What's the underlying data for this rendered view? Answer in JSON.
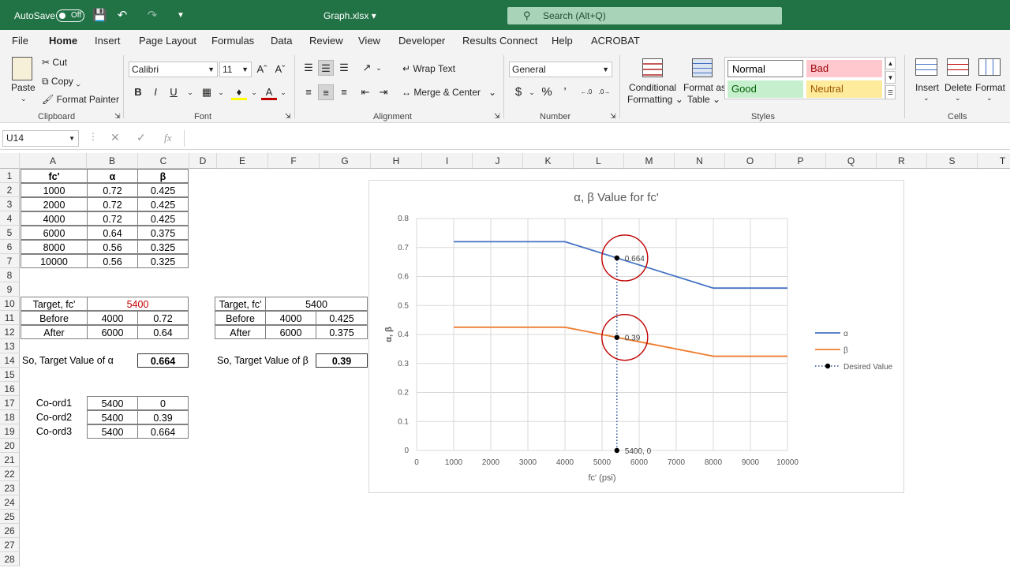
{
  "titlebar": {
    "autosave_label": "AutoSave",
    "autosave_state": "Off",
    "filename": "Graph.xlsx",
    "search_placeholder": "Search (Alt+Q)"
  },
  "menu": [
    "File",
    "Home",
    "Insert",
    "Page Layout",
    "Formulas",
    "Data",
    "Review",
    "View",
    "Developer",
    "Results Connect",
    "Help",
    "ACROBAT"
  ],
  "ribbon": {
    "clipboard": {
      "paste": "Paste",
      "cut": "Cut",
      "copy": "Copy",
      "format_painter": "Format Painter",
      "label": "Clipboard"
    },
    "font": {
      "name": "Calibri",
      "size": "11",
      "bold": "B",
      "italic": "I",
      "underline": "U",
      "label": "Font"
    },
    "alignment": {
      "wrap_text": "Wrap Text",
      "merge_center": "Merge & Center",
      "label": "Alignment"
    },
    "number": {
      "format": "General",
      "label": "Number"
    },
    "styles": {
      "conditional": "Conditional",
      "formatting": "Formatting",
      "format_as": "Format as",
      "table": "Table",
      "normal": "Normal",
      "bad": "Bad",
      "good": "Good",
      "neutral": "Neutral",
      "label": "Styles"
    },
    "cells": {
      "insert": "Insert",
      "delete": "Delete",
      "format": "Format",
      "label": "Cells"
    }
  },
  "formula": {
    "namebox": "U14",
    "fx": "fx",
    "value": ""
  },
  "columns": [
    "A",
    "B",
    "C",
    "D",
    "E",
    "F",
    "G",
    "H",
    "I",
    "J",
    "K",
    "L",
    "M",
    "N",
    "O",
    "P",
    "Q",
    "R",
    "S",
    "T"
  ],
  "rows": [
    "1",
    "2",
    "3",
    "4",
    "5",
    "6",
    "7",
    "8",
    "9",
    "10",
    "11",
    "12",
    "13",
    "14",
    "15",
    "16",
    "17",
    "18",
    "19",
    "20",
    "21",
    "22",
    "23",
    "24",
    "25",
    "26",
    "27",
    "28"
  ],
  "table1": {
    "headers": [
      "fc'",
      "α",
      "β"
    ],
    "rows": [
      [
        "1000",
        "0.72",
        "0.425"
      ],
      [
        "2000",
        "0.72",
        "0.425"
      ],
      [
        "4000",
        "0.72",
        "0.425"
      ],
      [
        "6000",
        "0.64",
        "0.375"
      ],
      [
        "8000",
        "0.56",
        "0.325"
      ],
      [
        "10000",
        "0.56",
        "0.325"
      ]
    ]
  },
  "alpha_calc": {
    "target_label": "Target, fc'",
    "target": "5400",
    "before_label": "Before",
    "before_fc": "4000",
    "before_val": "0.72",
    "after_label": "After",
    "after_fc": "6000",
    "after_val": "0.64",
    "result_label": "So, Target Value of α",
    "result": "0.664"
  },
  "beta_calc": {
    "target_label": "Target, fc'",
    "target": "5400",
    "before_label": "Before",
    "before_fc": "4000",
    "before_val": "0.425",
    "after_label": "After",
    "after_fc": "6000",
    "after_val": "0.375",
    "result_label": "So, Target Value of β",
    "result": "0.39"
  },
  "coords": [
    {
      "label": "Co-ord1",
      "x": "5400",
      "y": "0"
    },
    {
      "label": "Co-ord2",
      "x": "5400",
      "y": "0.39"
    },
    {
      "label": "Co-ord3",
      "x": "5400",
      "y": "0.664"
    }
  ],
  "chart_data": {
    "type": "line",
    "title": "α, β Value for fc'",
    "xlabel": "fc' (psi)",
    "ylabel": "α, β",
    "xlim": [
      0,
      10000
    ],
    "ylim": [
      0,
      0.8
    ],
    "xticks": [
      "0",
      "1000",
      "2000",
      "3000",
      "4000",
      "5000",
      "6000",
      "7000",
      "8000",
      "9000",
      "10000"
    ],
    "yticks": [
      "0",
      "0.1",
      "0.2",
      "0.3",
      "0.4",
      "0.5",
      "0.6",
      "0.7",
      "0.8"
    ],
    "grid": true,
    "legend": "right",
    "series": [
      {
        "name": "α",
        "color": "#4472c4",
        "x": [
          1000,
          2000,
          4000,
          6000,
          8000,
          10000
        ],
        "y": [
          0.72,
          0.72,
          0.72,
          0.64,
          0.56,
          0.56
        ]
      },
      {
        "name": "β",
        "color": "#ed7d31",
        "x": [
          1000,
          2000,
          4000,
          6000,
          8000,
          10000
        ],
        "y": [
          0.425,
          0.425,
          0.425,
          0.375,
          0.325,
          0.325
        ]
      },
      {
        "name": "Desired Value",
        "color": "#000000",
        "style": "dotted",
        "x": [
          5400,
          5400,
          5400
        ],
        "y": [
          0,
          0.39,
          0.664
        ]
      }
    ],
    "point_labels": [
      "5400, 0",
      "0.39",
      "0.664"
    ],
    "highlight_circles": [
      0.664,
      0.39
    ]
  }
}
